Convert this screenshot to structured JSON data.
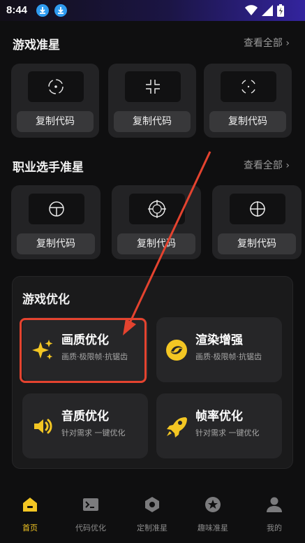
{
  "status": {
    "time": "8:44"
  },
  "sections": {
    "game_crosshair": {
      "title": "游戏准星",
      "more": "查看全部 ›"
    },
    "pro_crosshair": {
      "title": "职业选手准星",
      "more": "查看全部 ›"
    }
  },
  "copy_label": "复制代码",
  "optimization": {
    "title": "游戏优化",
    "items": [
      {
        "name": "画质优化",
        "sub": "画质·极限帧·抗锯齿",
        "icon": "sparkle-icon"
      },
      {
        "name": "渲染增强",
        "sub": "画质·极限帧·抗锯齿",
        "icon": "render-icon"
      },
      {
        "name": "音质优化",
        "sub": "针对需求 一键优化",
        "icon": "speaker-icon"
      },
      {
        "name": "帧率优化",
        "sub": "针对需求 一键优化",
        "icon": "rocket-icon"
      }
    ]
  },
  "tabs": [
    {
      "label": "首页",
      "icon": "home-icon",
      "active": true
    },
    {
      "label": "代码优化",
      "icon": "terminal-icon",
      "active": false
    },
    {
      "label": "定制准星",
      "icon": "hexagon-icon",
      "active": false
    },
    {
      "label": "趣味准星",
      "icon": "star-icon",
      "active": false
    },
    {
      "label": "我的",
      "icon": "user-icon",
      "active": false
    }
  ],
  "colors": {
    "accent": "#f3c623",
    "annotation": "#e4432f",
    "card": "#232325"
  }
}
